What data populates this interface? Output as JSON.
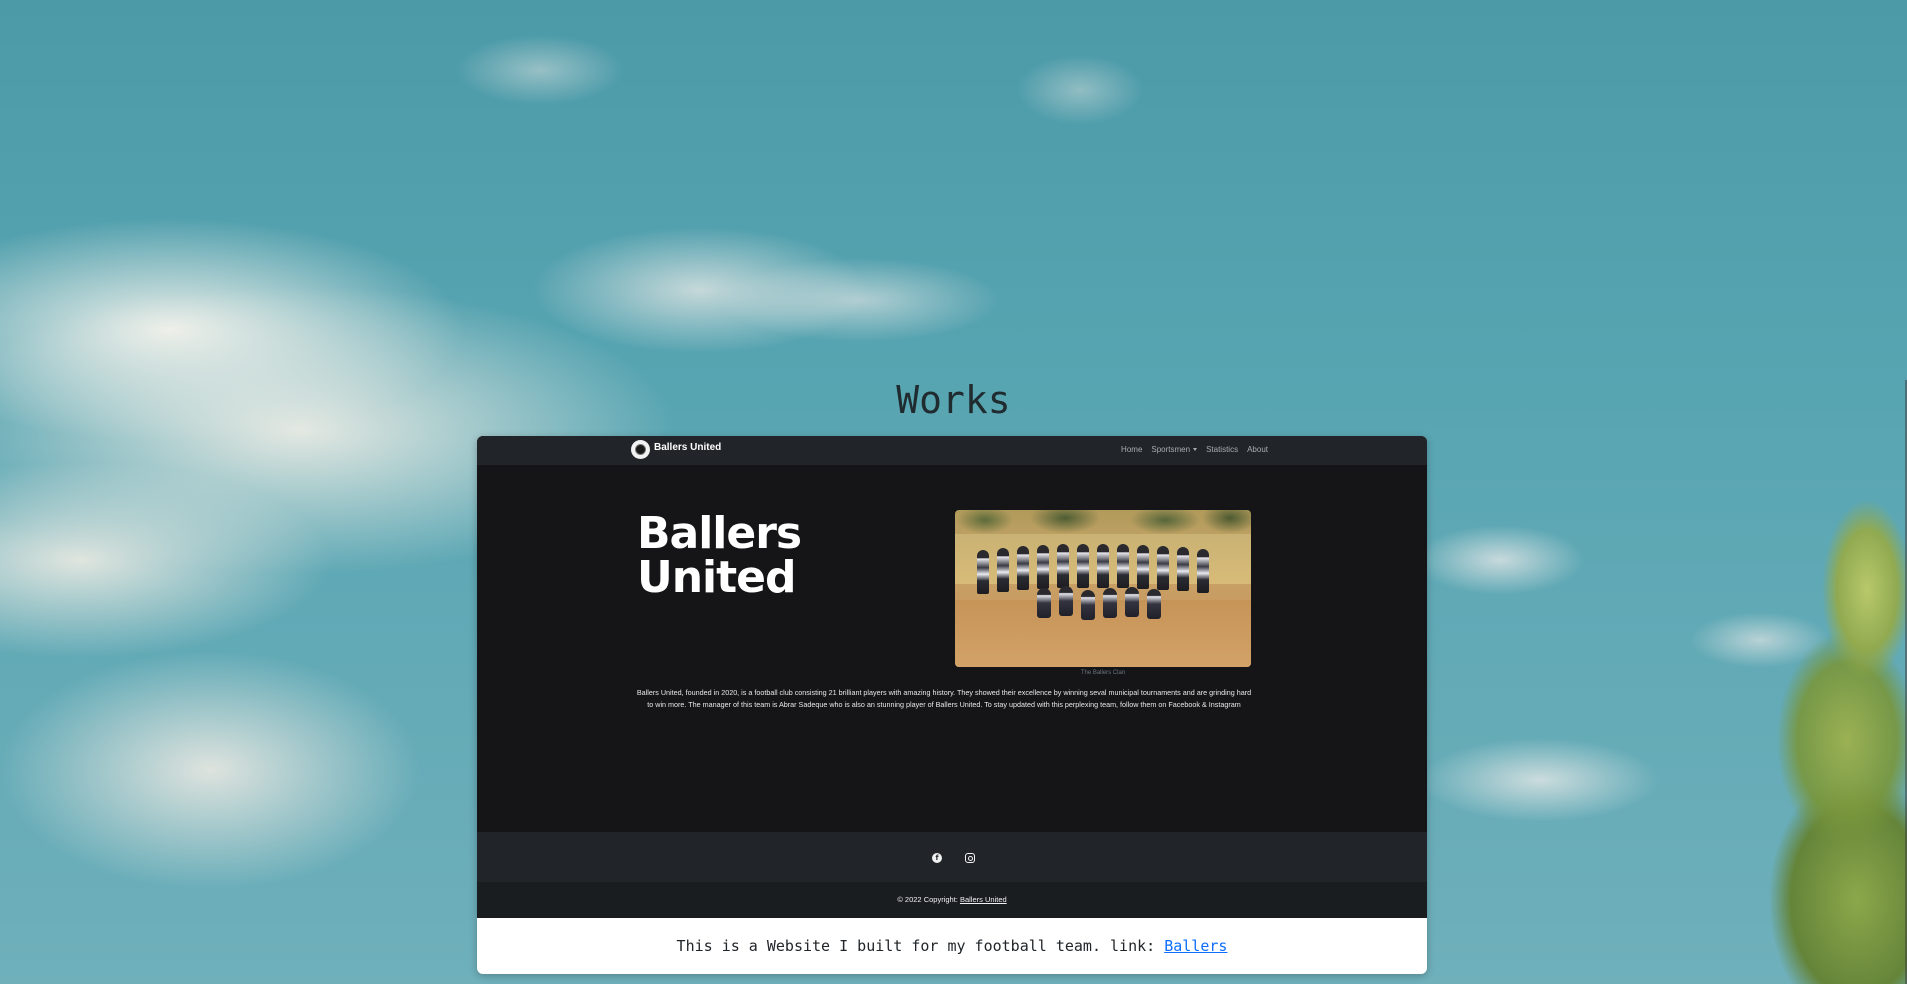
{
  "section": {
    "title": "Works"
  },
  "work": {
    "description": "This is a Website I built for my football team. link:",
    "link_label": "Ballers"
  },
  "preview": {
    "brand": "Ballers United",
    "nav": {
      "items": [
        "Home",
        "Sportsmen",
        "Statistics",
        "About"
      ]
    },
    "heading": "Ballers United",
    "photo_caption": "The Ballers Clan",
    "about_text": "Ballers United, founded in 2020, is a football club consisting 21 brilliant players with amazing history. They showed their excellence by winning seval municipal tournaments and are grinding hard to win more. The manager of this team is Abrar Sadeque who is also an stunning player of Ballers United. To stay updated with this perplexing team, follow them on Facebook & Instagram",
    "footer": {
      "copyright": "© 2022 Copyright:",
      "link": "Ballers United"
    },
    "social_icons": [
      "facebook-icon",
      "instagram-icon"
    ]
  },
  "colors": {
    "preview_bg": "#151517",
    "navbar_bg": "#212529",
    "footer_bg": "#1a1d20",
    "link": "#0d6efd"
  }
}
